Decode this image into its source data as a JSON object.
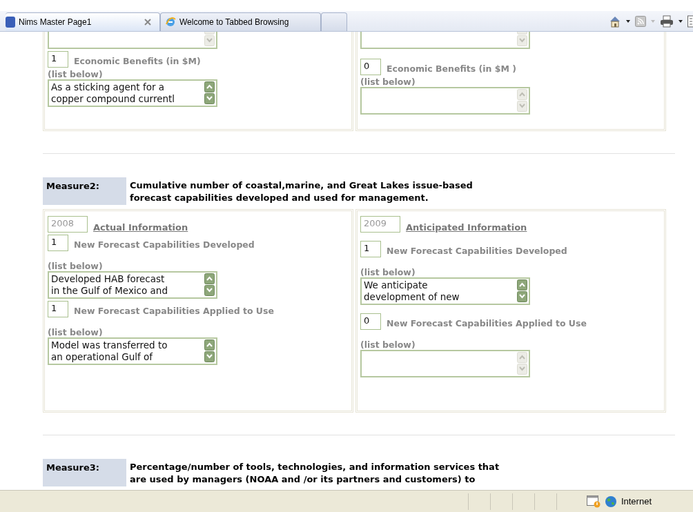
{
  "browser": {
    "tabs": [
      {
        "label": "Nims Master Page1",
        "selected": true,
        "kind": "page"
      },
      {
        "label": "Welcome to Tabbed Browsing",
        "selected": false,
        "kind": "ie"
      }
    ]
  },
  "top_section": {
    "columns": [
      {
        "previous_list": {
          "scroll_enabled": false
        },
        "items": [
          {
            "value": "1",
            "label": "Economic Benefits (in $M)",
            "list_label": "(list below)",
            "list_text": "As a sticking agent for a\ncopper compound currentl",
            "scroll_enabled": true
          }
        ]
      },
      {
        "previous_list": {
          "scroll_enabled": false
        },
        "items": [
          {
            "value": "0",
            "label": "Economic Benefits (in $M )",
            "list_label": "(list below)",
            "scroll_enabled": false
          }
        ]
      }
    ]
  },
  "measures": [
    {
      "label": "Measure2:",
      "description": "Cumulative number of coastal,marine, and Great Lakes issue-based\nforecast capabilities developed and used for management.",
      "columns": [
        {
          "year": "2008",
          "heading": "Actual Information",
          "items": [
            {
              "value": "1",
              "label": "New Forecast Capabilities Developed",
              "list_label": "(list below)",
              "list_text": "Developed HAB forecast\nin the Gulf of Mexico and",
              "scroll_enabled": true
            },
            {
              "value": "1",
              "label": "New Forecast Capabilities Applied to Use",
              "list_label": "(list below)",
              "list_text": "Model was transferred to\nan operational Gulf of",
              "scroll_enabled": true
            }
          ]
        },
        {
          "year": "2009",
          "heading": "Anticipated Information",
          "items": [
            {
              "value": "1",
              "label": "New Forecast Capabilities Developed",
              "list_label": "(list below)",
              "list_text": "We anticipate\ndevelopment of new",
              "scroll_enabled": true
            },
            {
              "value": "0",
              "label": "New Forecast Capabilities Applied to Use",
              "list_label": "(list below)",
              "scroll_enabled": false
            }
          ]
        }
      ]
    },
    {
      "label": "Measure3:",
      "description": "Percentage/number of tools, technologies, and information services that\nare used by managers (NOAA and /or its partners and customers) to"
    }
  ],
  "status_bar": {
    "zone": "Internet"
  }
}
